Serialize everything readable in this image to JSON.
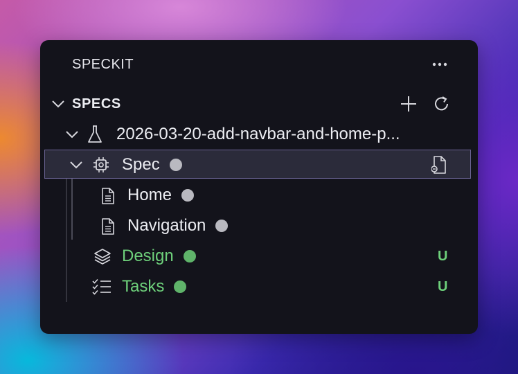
{
  "panel": {
    "title": "SPECKIT"
  },
  "specs_section": {
    "label": "SPECS"
  },
  "tree": {
    "spec_folder": "2026-03-20-add-navbar-and-home-p...",
    "spec": {
      "label": "Spec"
    },
    "children": [
      {
        "label": "Home"
      },
      {
        "label": "Navigation"
      }
    ],
    "design": {
      "label": "Design",
      "badge": "U"
    },
    "tasks": {
      "label": "Tasks",
      "badge": "U"
    }
  },
  "colors": {
    "panel_bg": "#13131b",
    "selection_bg": "#2b2b3a",
    "selection_border": "#6a6393",
    "untracked_green": "#6ed07b",
    "status_gray": "#b9b9c0"
  },
  "icons": [
    "more-icon",
    "chevron-down-icon",
    "add-icon",
    "refresh-icon",
    "flask-icon",
    "chip-icon",
    "file-link-icon",
    "file-icon",
    "layers-icon",
    "checklist-icon"
  ]
}
